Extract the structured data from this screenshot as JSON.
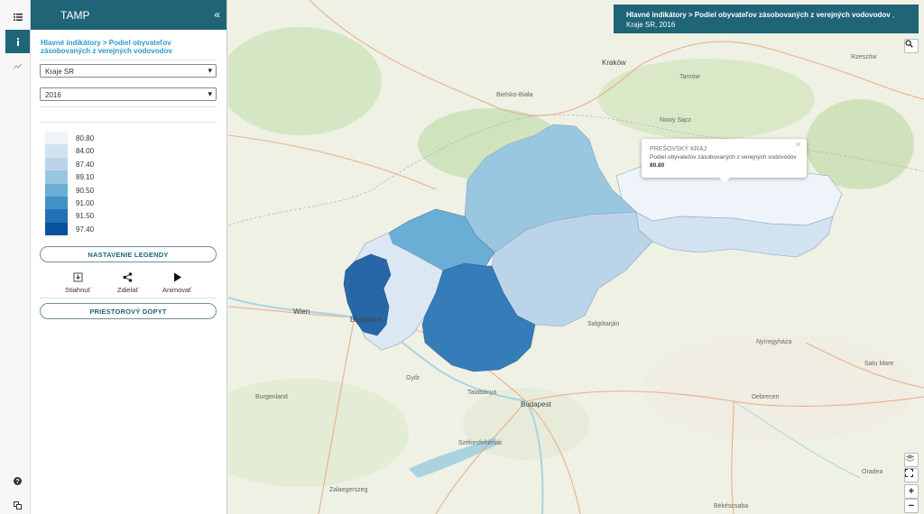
{
  "panel": {
    "title": "TAMP",
    "breadcrumb": "Hlavné indikátory > Podiel obyvateľov zásobovaných z verejných vodovodov",
    "region_select": "Kraje SR",
    "year_select": "2016",
    "legend": [
      {
        "value": "80.80",
        "color": "#eef4fa"
      },
      {
        "value": "84.00",
        "color": "#d2e2f1"
      },
      {
        "value": "87.40",
        "color": "#bcd4ea"
      },
      {
        "value": "89.10",
        "color": "#9ac7e0"
      },
      {
        "value": "90.50",
        "color": "#6aaed6"
      },
      {
        "value": "91.00",
        "color": "#4292c6"
      },
      {
        "value": "91.50",
        "color": "#2171b5"
      },
      {
        "value": "97.40",
        "color": "#08519c"
      }
    ],
    "legend_button": "NASTAVENIE LEGENDY",
    "actions": {
      "download": "Stiahnuť",
      "share": "Zdielať",
      "animate": "Animovať"
    },
    "spatial_button": "PRIESTOROVÝ DOPYT"
  },
  "map": {
    "title_path": "Hlavné indikátory > Podiel obyvateľov zásobovaných z verejných vodovodov",
    "title_suffix": " , Kraje SR, 2016",
    "popup": {
      "region": "PREŠOVSKÝ KRAJ",
      "indicator": "Podiel obyvateľov zásobovaných z verejných vodovodov",
      "value": "80.80"
    },
    "places": {
      "krakow": "Kraków",
      "wien": "Wien",
      "bratislava": "Bratislava",
      "budapest": "Budapest",
      "debrecen": "Debrecen",
      "nyiregyhaza": "Nyíregyháza",
      "salgotarjan": "Salgótarján",
      "tatabanya": "Tatabánya",
      "gyor": "Győr",
      "szekesfehervar": "Székesfehérvár",
      "zalaegerszeg": "Zalaegerszeg",
      "bekescsaba": "Békéscsaba",
      "bielsko": "Bielsko-Biała",
      "nowy_sacz": "Nowy Sącz",
      "tarnow": "Tarnów",
      "rzeszow": "Rzeszów",
      "satu_mare": "Satu Mare",
      "oradea": "Oradea",
      "burgenland": "Burgenland"
    },
    "regions": {
      "presovsky": "80.80",
      "kosicky": "84.00",
      "banskobystricky": "87.40",
      "zilinsky": "89.10",
      "trenciansky": "90.50",
      "trnavsky": "91.00",
      "nitriansky": "91.50",
      "bratislavsky": "97.40"
    }
  }
}
